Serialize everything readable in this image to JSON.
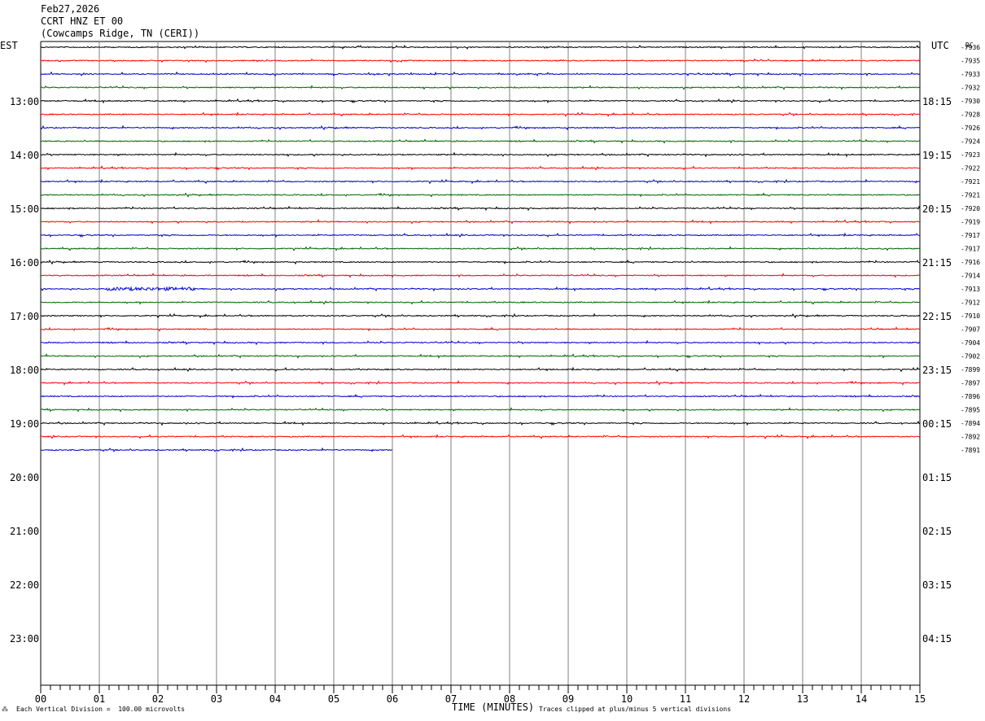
{
  "header": {
    "date": "Feb27,2026",
    "station": "CCRT HNZ ET 00",
    "location": "(Cowcamps Ridge, TN (CERI))"
  },
  "axis": {
    "left_label": "EST",
    "right_label": "UTC",
    "dc_label": "DC",
    "x_title": "TIME (MINUTES)"
  },
  "footer": {
    "left": "Each Vertical Division =  100.00 microvolts",
    "right": "Traces clipped at plus/minus 5 vertical divisions"
  },
  "chart_data": {
    "type": "line",
    "title": "CCRT HNZ ET 00",
    "xlabel": "TIME (MINUTES)",
    "xlim": [
      0,
      15
    ],
    "x_ticks": [
      "00",
      "01",
      "02",
      "03",
      "04",
      "05",
      "06",
      "07",
      "08",
      "09",
      "10",
      "11",
      "12",
      "13",
      "14",
      "15"
    ],
    "left_time_labels": [
      "13:00",
      "14:00",
      "15:00",
      "16:00",
      "17:00",
      "18:00",
      "19:00",
      "20:00",
      "21:00",
      "22:00",
      "23:00"
    ],
    "right_time_labels": [
      "18:15",
      "19:15",
      "20:15",
      "21:15",
      "22:15",
      "23:15",
      "00:15",
      "01:15",
      "02:15",
      "03:15",
      "04:15"
    ],
    "colors": [
      "#000000",
      "#ff0000",
      "#0000cc",
      "#006600"
    ],
    "traces": [
      {
        "dc": "-7936",
        "color": "#000000",
        "end_minute": 15
      },
      {
        "dc": "-7935",
        "color": "#ff0000",
        "end_minute": 15
      },
      {
        "dc": "-7933",
        "color": "#0000cc",
        "end_minute": 15
      },
      {
        "dc": "-7932",
        "color": "#006600",
        "end_minute": 15
      },
      {
        "dc": "-7930",
        "color": "#000000",
        "end_minute": 15
      },
      {
        "dc": "-7928",
        "color": "#ff0000",
        "end_minute": 15
      },
      {
        "dc": "-7926",
        "color": "#0000cc",
        "end_minute": 15
      },
      {
        "dc": "-7924",
        "color": "#006600",
        "end_minute": 15
      },
      {
        "dc": "-7923",
        "color": "#000000",
        "end_minute": 15
      },
      {
        "dc": "-7922",
        "color": "#ff0000",
        "end_minute": 15
      },
      {
        "dc": "-7921",
        "color": "#0000cc",
        "end_minute": 15
      },
      {
        "dc": "-7921",
        "color": "#006600",
        "end_minute": 15
      },
      {
        "dc": "-7920",
        "color": "#000000",
        "end_minute": 15
      },
      {
        "dc": "-7919",
        "color": "#ff0000",
        "end_minute": 15
      },
      {
        "dc": "-7917",
        "color": "#0000cc",
        "end_minute": 15
      },
      {
        "dc": "-7917",
        "color": "#006600",
        "end_minute": 15
      },
      {
        "dc": "-7916",
        "color": "#000000",
        "end_minute": 15
      },
      {
        "dc": "-7914",
        "color": "#ff0000",
        "end_minute": 15
      },
      {
        "dc": "-7913",
        "color": "#0000cc",
        "end_minute": 15
      },
      {
        "dc": "-7912",
        "color": "#006600",
        "end_minute": 15
      },
      {
        "dc": "-7910",
        "color": "#000000",
        "end_minute": 15
      },
      {
        "dc": "-7907",
        "color": "#ff0000",
        "end_minute": 15
      },
      {
        "dc": "-7904",
        "color": "#0000cc",
        "end_minute": 15
      },
      {
        "dc": "-7902",
        "color": "#006600",
        "end_minute": 15
      },
      {
        "dc": "-7899",
        "color": "#000000",
        "end_minute": 15
      },
      {
        "dc": "-7897",
        "color": "#ff0000",
        "end_minute": 15
      },
      {
        "dc": "-7896",
        "color": "#0000cc",
        "end_minute": 15
      },
      {
        "dc": "-7895",
        "color": "#006600",
        "end_minute": 15
      },
      {
        "dc": "-7894",
        "color": "#000000",
        "end_minute": 15
      },
      {
        "dc": "-7892",
        "color": "#ff0000",
        "end_minute": 15
      },
      {
        "dc": "-7891",
        "color": "#0000cc",
        "end_minute": 6
      }
    ]
  }
}
